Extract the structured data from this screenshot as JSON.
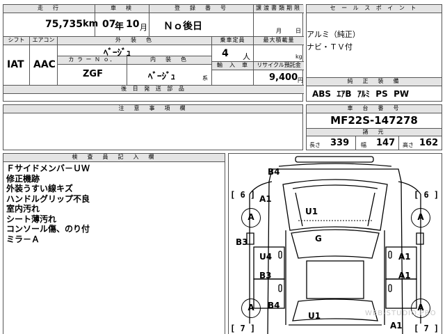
{
  "top_row": {
    "mileage_label": "走　行",
    "mileage_value": "75,735",
    "mileage_unit": "km",
    "shaken_label": "車　検",
    "shaken_year": "07",
    "shaken_year_unit": "年",
    "shaken_month": "10",
    "shaken_month_unit": "月",
    "reg_label": "登　録　番　号",
    "reg_value": "Ｎｏ後日",
    "transfer_label": "譲渡書類期限",
    "transfer_month": "月",
    "transfer_day": "日"
  },
  "sales_point": {
    "label": "セ ー ル ス ポ イ ン ト",
    "lines": [
      "アルミ（純正）",
      "ナビ・ＴＶ付"
    ]
  },
  "second_row": {
    "shift_label": "シフト",
    "shift_value": "IAT",
    "aircon_label": "エアコン",
    "aircon_value": "AAC",
    "ext_color_label": "外　装　色",
    "ext_color_value": "ﾍﾞｰｼﾞｭ",
    "color_no_label": "カ ラ ー Ｎ ｏ．",
    "color_no_value": "ZGF",
    "int_color_label": "内　装　色",
    "int_color_value": "ﾍﾞｰｼﾞｭ",
    "int_color_suffix": "系",
    "capacity_label": "乗車定員",
    "capacity_value": "4",
    "capacity_unit": "人",
    "load_label": "最大積載量",
    "load_unit": "kg",
    "import_label": "輸　入　車",
    "recycle_label": "リサイクル預託金",
    "recycle_value": "9,400",
    "recycle_unit": "円"
  },
  "later_items": {
    "label": "後 日 発 送 部 品"
  },
  "genuine_equipment": {
    "label": "純　正　装　備",
    "value": "ABS  ｴｱB  ｱﾙﾐ  PS  PW"
  },
  "caution": {
    "label": "注　意　事　項　欄"
  },
  "chassis": {
    "label": "車　台　番　号",
    "value": "MF22S-147278",
    "dims_label": "諸　元",
    "length_label": "長さ",
    "length_value": "339",
    "width_label": "幅",
    "width_value": "147",
    "height_label": "高さ",
    "height_value": "162"
  },
  "inspector": {
    "label": "検　査　員　記　入　欄",
    "lines": [
      "Ｆサイドメンバ－ＵＷ",
      "修正機跡",
      "外装うすい線キズ",
      "ハンドルグリップ不良",
      "室内汚れ",
      "シート薄汚れ",
      "コンソール傷、のり付",
      "ミラ－Ａ"
    ]
  },
  "diagram": {
    "marks": {
      "b4_top": "B4",
      "a1_front_left": "A1",
      "u1_hood": "U1",
      "bracket_6_left": "[ 6 ]",
      "bracket_6_right": "[ 6 ]",
      "wheel_a_fl": "A",
      "wheel_a_fr": "A",
      "wheel_a_rl": "A",
      "wheel_a_rr": "A",
      "b3_left": "B3",
      "g_glass": "G",
      "u4_door": "U4",
      "a1_door_right_front": "A1",
      "b3_door": "B3",
      "a1_door_right_rear": "A1",
      "b4_rear": "B4",
      "u1_rear": "U1",
      "a1_rear_right": "A1",
      "bracket_7_left": "[ 7 ]",
      "bracket_7_right": "[ 7 ]"
    },
    "watermark": "WEB-STUDIO.PRO"
  }
}
